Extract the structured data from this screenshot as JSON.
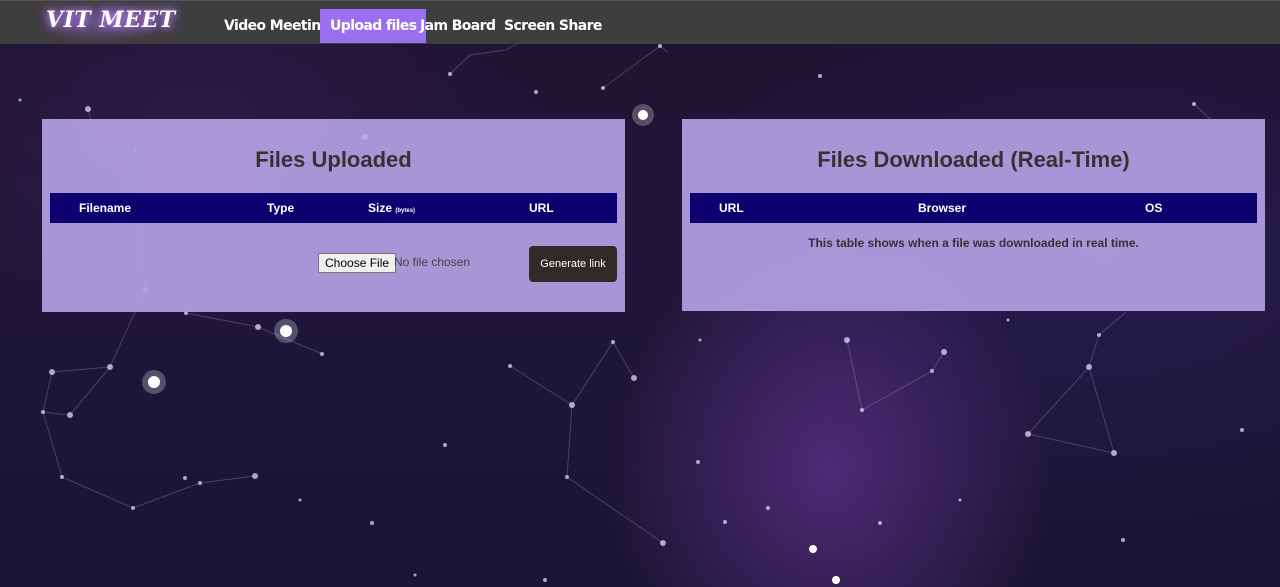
{
  "navbar": {
    "brand": "VIT MEET",
    "items": [
      {
        "label": "Video Meeting",
        "active": false
      },
      {
        "label": "Upload files",
        "active": true
      },
      {
        "label": "Jam Board",
        "active": false
      },
      {
        "label": "Screen Share",
        "active": false
      }
    ]
  },
  "uploads": {
    "title": "Files Uploaded",
    "columns": {
      "filename": "Filename",
      "type": "Type",
      "size": "Size",
      "size_unit": "(bytes)",
      "url": "URL"
    },
    "file_button": "Choose File",
    "file_status": "No file chosen",
    "generate_button": "Generate link"
  },
  "downloads": {
    "title": "Files Downloaded (Real-Time)",
    "columns": {
      "url": "URL",
      "browser": "Browser",
      "os": "OS"
    },
    "note": "This table shows when a file was downloaded in real time."
  },
  "colors": {
    "accent": "#9a6ff0",
    "header_bg": "#0e006e",
    "panel_bg": "#b2a0e2"
  }
}
